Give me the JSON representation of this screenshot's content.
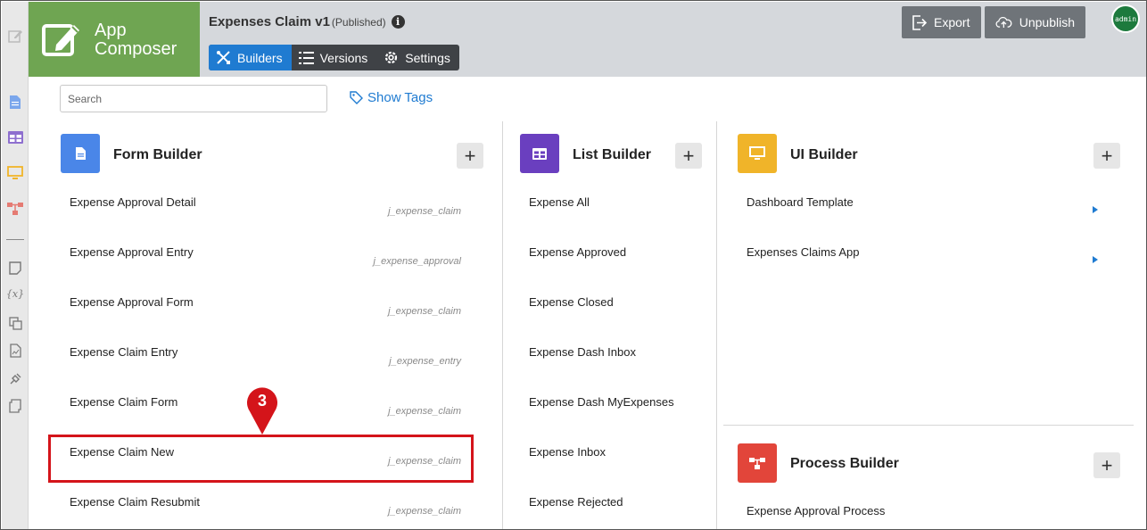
{
  "app": {
    "brand_line1": "App",
    "brand_line2": "Composer",
    "title": "Expenses Claim v1",
    "status": "(Published)",
    "info_icon": "i"
  },
  "tabs": [
    {
      "label": "Builders",
      "icon": "tools-icon",
      "active": true
    },
    {
      "label": "Versions",
      "icon": "list-icon",
      "active": false
    },
    {
      "label": "Settings",
      "icon": "gear-icon",
      "active": false
    }
  ],
  "toolbar": {
    "export_label": "Export",
    "unpublish_label": "Unpublish",
    "avatar_text": "admin"
  },
  "search": {
    "placeholder": "Search",
    "show_tags_label": "Show Tags"
  },
  "form_builder": {
    "title": "Form Builder",
    "color": "#4a86e8",
    "items": [
      {
        "label": "Expense Approval Detail",
        "tag": "j_expense_claim"
      },
      {
        "label": "Expense Approval Entry",
        "tag": "j_expense_approval"
      },
      {
        "label": "Expense Approval Form",
        "tag": "j_expense_claim"
      },
      {
        "label": "Expense Claim Entry",
        "tag": "j_expense_entry"
      },
      {
        "label": "Expense Claim Form",
        "tag": "j_expense_claim"
      },
      {
        "label": "Expense Claim New",
        "tag": "j_expense_claim"
      },
      {
        "label": "Expense Claim Resubmit",
        "tag": "j_expense_claim"
      }
    ]
  },
  "list_builder": {
    "title": "List Builder",
    "color": "#6a3fbf",
    "items": [
      "Expense All",
      "Expense Approved",
      "Expense Closed",
      "Expense Dash Inbox",
      "Expense Dash MyExpenses",
      "Expense Inbox",
      "Expense Rejected"
    ]
  },
  "ui_builder": {
    "title": "UI Builder",
    "color": "#f0b429",
    "items": [
      "Dashboard Template",
      "Expenses Claims App"
    ]
  },
  "process_builder": {
    "title": "Process Builder",
    "color": "#e2453a",
    "items": [
      "Expense Approval Process"
    ]
  },
  "add_label": "+",
  "callout": {
    "number": "3",
    "color": "#d4141a"
  }
}
